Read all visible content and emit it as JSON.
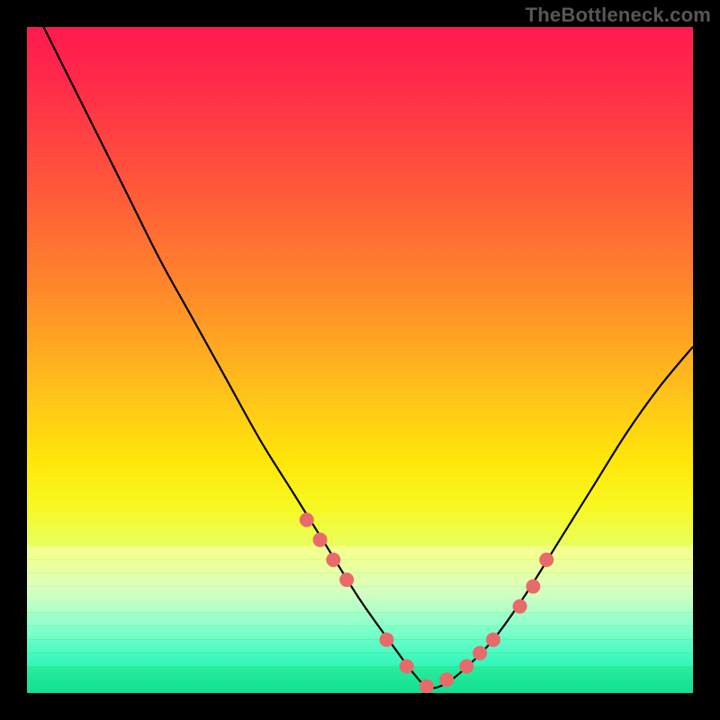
{
  "watermark": "TheBottleneck.com",
  "colors": {
    "frame_bg": "#000000",
    "curve": "#000000",
    "marker_fill": "#e96a6a",
    "marker_stroke": "#c94a4a"
  },
  "chart_data": {
    "type": "line",
    "title": "",
    "xlabel": "",
    "ylabel": "",
    "xlim": [
      0,
      100
    ],
    "ylim": [
      0,
      100
    ],
    "grid": false,
    "legend": null,
    "series": [
      {
        "name": "bottleneck-curve",
        "x": [
          0,
          5,
          10,
          15,
          20,
          25,
          30,
          35,
          40,
          45,
          50,
          55,
          58,
          60,
          62,
          65,
          70,
          75,
          80,
          85,
          90,
          95,
          100
        ],
        "values": [
          105,
          95,
          85,
          75,
          65,
          56,
          47,
          38,
          30,
          22,
          14,
          7,
          3,
          1,
          1,
          3,
          8,
          15,
          23,
          31,
          39,
          46,
          52
        ]
      }
    ],
    "markers": {
      "name": "highlighted-points",
      "x": [
        42,
        44,
        46,
        48,
        54,
        57,
        60,
        63,
        66,
        68,
        70,
        74,
        76,
        78
      ],
      "values": [
        26,
        23,
        20,
        17,
        8,
        4,
        1,
        2,
        4,
        6,
        8,
        13,
        16,
        20
      ]
    },
    "gradient_bands_y": [
      78,
      80,
      82,
      84,
      86,
      88,
      90,
      92,
      94
    ]
  }
}
